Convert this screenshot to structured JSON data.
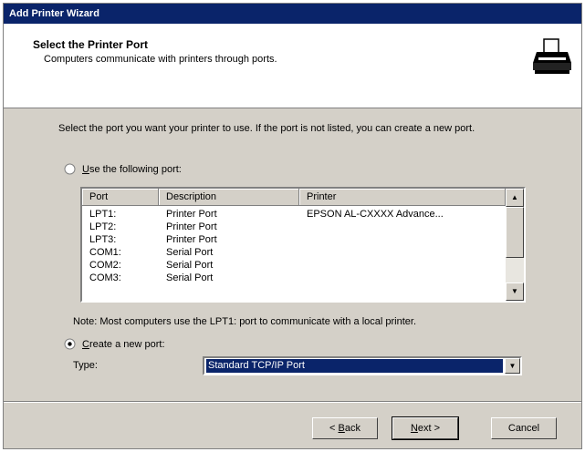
{
  "window": {
    "title": "Add Printer Wizard"
  },
  "header": {
    "title": "Select the Printer Port",
    "subtitle": "Computers communicate with printers through ports.",
    "icon": "printer-icon"
  },
  "intro": "Select the port you want your printer to use.  If the port is not listed, you can create a new port.",
  "use_existing": {
    "label_accel": "U",
    "label_rest": "se the following port:",
    "selected": false
  },
  "port_table": {
    "columns": [
      "Port",
      "Description",
      "Printer"
    ],
    "rows": [
      {
        "port": "LPT1:",
        "description": "Printer Port",
        "printer": "EPSON AL-CXXXX Advance..."
      },
      {
        "port": "LPT2:",
        "description": "Printer Port",
        "printer": ""
      },
      {
        "port": "LPT3:",
        "description": "Printer Port",
        "printer": ""
      },
      {
        "port": "COM1:",
        "description": "Serial Port",
        "printer": ""
      },
      {
        "port": "COM2:",
        "description": "Serial Port",
        "printer": ""
      },
      {
        "port": "COM3:",
        "description": "Serial Port",
        "printer": ""
      }
    ]
  },
  "note": "Note: Most computers use the LPT1: port to communicate with a local printer.",
  "create_new": {
    "label_accel": "C",
    "label_rest": "reate a new port:",
    "selected": true
  },
  "type": {
    "label": "Type:",
    "value": "Standard TCP/IP Port"
  },
  "buttons": {
    "back_accel": "B",
    "back_rest": "ack",
    "back_prefix": "< ",
    "next_accel": "N",
    "next_rest": "ext >",
    "cancel": "Cancel"
  }
}
